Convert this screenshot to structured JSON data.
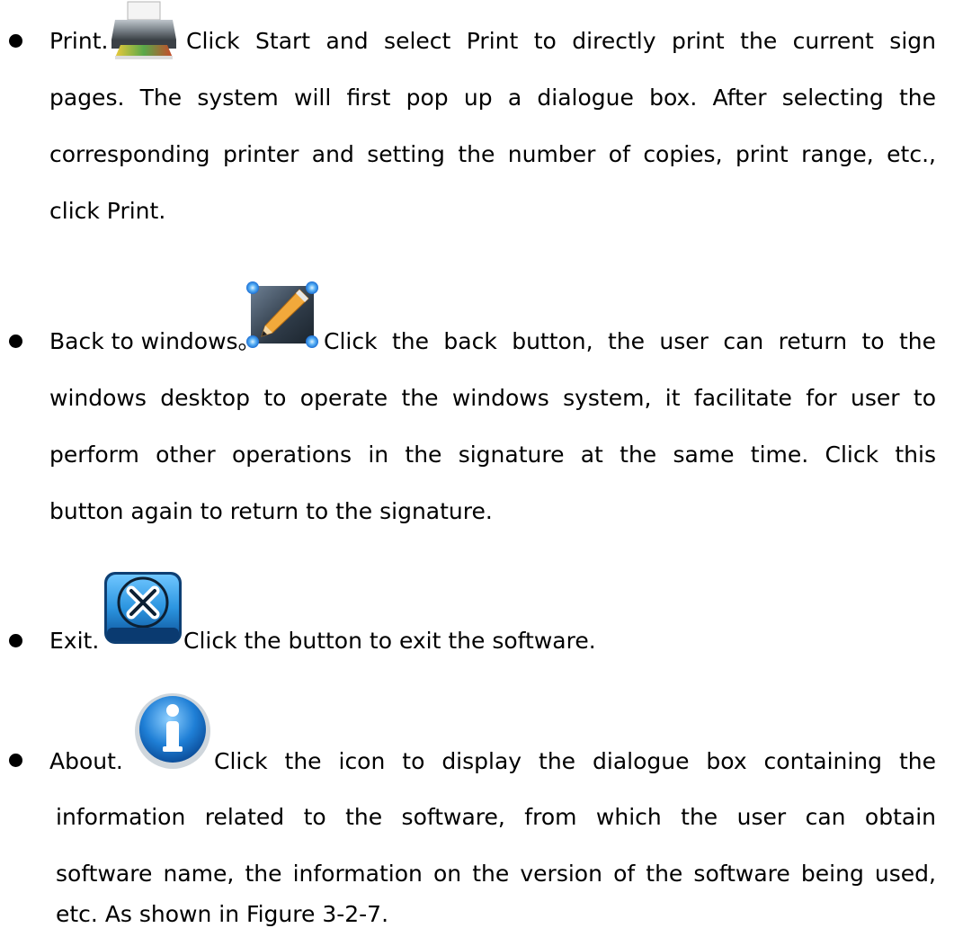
{
  "items": [
    {
      "label": "Print.",
      "icon": "printer-icon",
      "lines": [
        "Click Start and select Print to directly print the current sign",
        "pages. The system will first pop up a dialogue box. After selecting the",
        "corresponding printer and setting the number of copies, print range, etc.,",
        "click Print."
      ]
    },
    {
      "label": "Back to windows。",
      "icon": "pencil-icon",
      "lines": [
        "Click the back button, the user can return to the",
        "windows desktop to operate the windows system, it facilitate for user to",
        "perform other operations in the signature at the same time. Click this",
        "button again to return to the signature."
      ]
    },
    {
      "label": "Exit.",
      "icon": "close-icon",
      "lines": [
        "Click the button to exit the software."
      ]
    },
    {
      "label": "About.",
      "icon": "info-icon",
      "lines": [
        "Click the icon to display the dialogue box containing the",
        "information related to the software, from which the user can obtain",
        "software name, the information on the version of the software being used,",
        "etc. As shown in Figure 3-2-7."
      ]
    }
  ]
}
